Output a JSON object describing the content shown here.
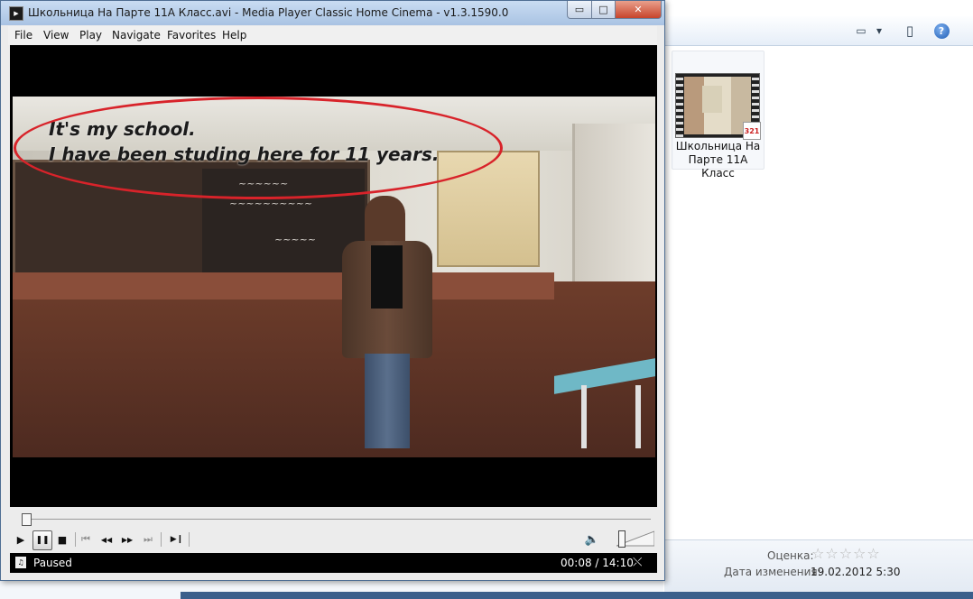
{
  "explorer": {
    "view_icon": "▭",
    "view_dropdown": "▾",
    "pane_icon": "▯",
    "help_label": "?",
    "file": {
      "name": "Школьница На Парте 11А Класс",
      "badge": "321"
    },
    "details": {
      "rating_label": "Оценка:",
      "stars": "☆☆☆☆☆",
      "date_label": "Дата изменения:",
      "date_value": "19.02.2012 5:30"
    }
  },
  "player": {
    "title": "Школьница На Парте 11А Класс.avi - Media Player Classic Home Cinema - v1.3.1590.0",
    "window_buttons": {
      "minimize": "▭",
      "maximize": "□",
      "close": "✕"
    },
    "menu": [
      "File",
      "View",
      "Play",
      "Navigate",
      "Favorites",
      "Help"
    ],
    "video": {
      "subtitle_line1": "It's my school.",
      "subtitle_line2": "I have been studing here for 11 years."
    },
    "controls": {
      "play": "▶",
      "pause": "❚❚",
      "stop": "■",
      "prev": "⏮",
      "rewind": "◀◀",
      "forward": "▶▶",
      "next": "⏭",
      "frame_step": "▶❙",
      "volume_icon": "🔈"
    },
    "progress": {
      "position_fraction": 0.0094
    },
    "status": {
      "state": "Paused",
      "time": "00:08 / 14:10",
      "network_icon": "⤬"
    },
    "accent_colors": {
      "annotation_red": "#d8232a",
      "title_bar": "#bcd3ee"
    }
  }
}
